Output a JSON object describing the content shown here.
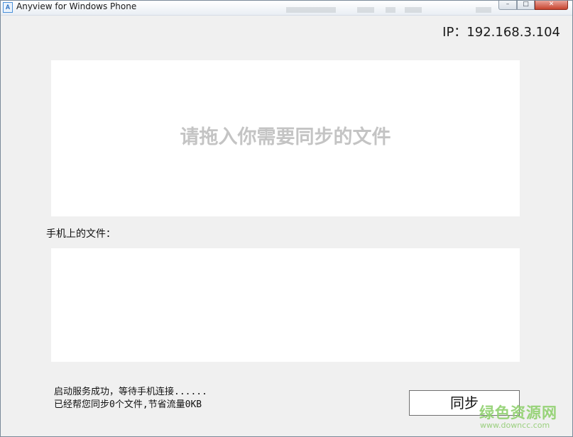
{
  "window": {
    "title": "Anyview for Windows Phone",
    "icon_letter": "A",
    "controls": {
      "minimize": "–",
      "maximize": "□",
      "close": "✕"
    }
  },
  "header": {
    "ip_label": "IP：192.168.3.104"
  },
  "drop_zone": {
    "hint": "请拖入你需要同步的文件"
  },
  "phone_files": {
    "label": "手机上的文件：",
    "items": []
  },
  "status": {
    "line1": "启动服务成功，等待手机连接......",
    "line2": "已经帮您同步0个文件,节省流量0KB"
  },
  "actions": {
    "sync_label": "同步"
  },
  "watermark": {
    "logo": "绿色资源网",
    "url": "www.downcc.com"
  }
}
